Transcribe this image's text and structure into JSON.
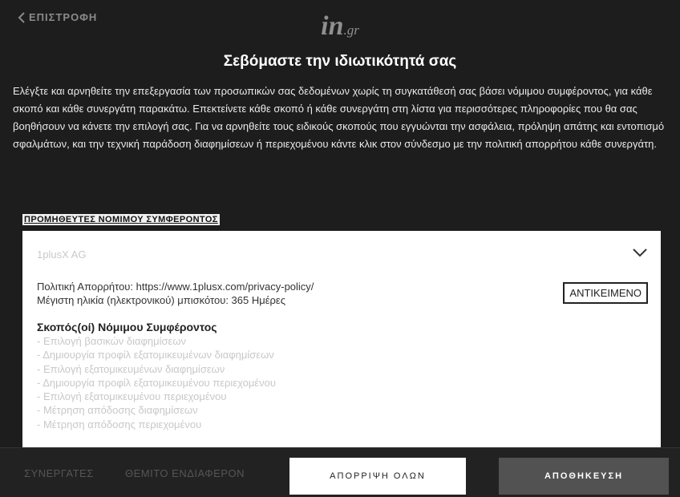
{
  "header": {
    "back_label": "ΕΠΙΣΤΡΟΦΗ",
    "logo_main": "in",
    "logo_sub": ".gr",
    "title": "Σεβόμαστε την ιδιωτικότητά σας"
  },
  "intro_text": "Ελέγξτε και αρνηθείτε την επεξεργασία των προσωπικών σας δεδομένων χωρίς τη συγκατάθεσή σας βάσει νόμιμου συμφέροντος, για κάθε σκοπό και κάθε συνεργάτη παρακάτω. Επεκτείνετε κάθε σκοπό ή κάθε συνεργάτη στη λίστα για περισσότερες πληροφορίες που θα σας βοηθήσουν να κάνετε την επιλογή σας. Για να αρνηθείτε τους ειδικούς σκοπούς που εγγυώνται την ασφάλεια, πρόληψη απάτης και εντοπισμό σφαλμάτων, και την τεχνική παράδοση διαφημίσεων ή περιεχομένου κάντε κλικ στον σύνδεσμο με την πολιτική απορρήτου κάθε συνεργάτη.",
  "section_label": "ΠΡΟΜΗΘΕΥΤΕΣ ΝΟΜΙΜΟΥ ΣΥΜΦΕΡΟΝΤΟΣ",
  "vendor": {
    "name": "1plusX AG",
    "policy": "Πολιτική Απορρήτου: https://www.1plusx.com/privacy-policy/",
    "cookie_age": "Μέγιστη ηλικία (ηλεκτρονικού) μπισκότου: 365 Ημέρες",
    "object_label": "ΑΝΤΙΚΕΙΜΕΝΟ",
    "purposes_title": "Σκοπός(οί) Νόμιμου Συμφέροντος",
    "purposes": [
      "- Επιλογή βασικών διαφημίσεων",
      "- Δημιουργία προφίλ εξατομικευμένων διαφημίσεων",
      "- Επιλογή εξατομικευμένων διαφημίσεων",
      "- Δημιουργία προφίλ εξατομικευμένου περιεχομένου",
      "- Επιλογή εξατομικευμένου περιεχομένου",
      "- Μέτρηση απόδοσης διαφημίσεων",
      "- Μέτρηση απόδοσης περιεχομένου"
    ]
  },
  "footer": {
    "tab_partners": "ΣΥΝΕΡΓΑΤΕΣ",
    "tab_legit": "ΘΕΜΙΤΟ ΕΝΔΙΑΦΕΡΟΝ",
    "reject_all": "ΑΠΟΡΡΙΨΗ ΟΛΩΝ",
    "save": "ΑΠΟΘΗΚΕΥΣΗ"
  },
  "colors": {
    "background": "#1d1d1d",
    "save_button": "#525252",
    "card": "#ffffff"
  }
}
